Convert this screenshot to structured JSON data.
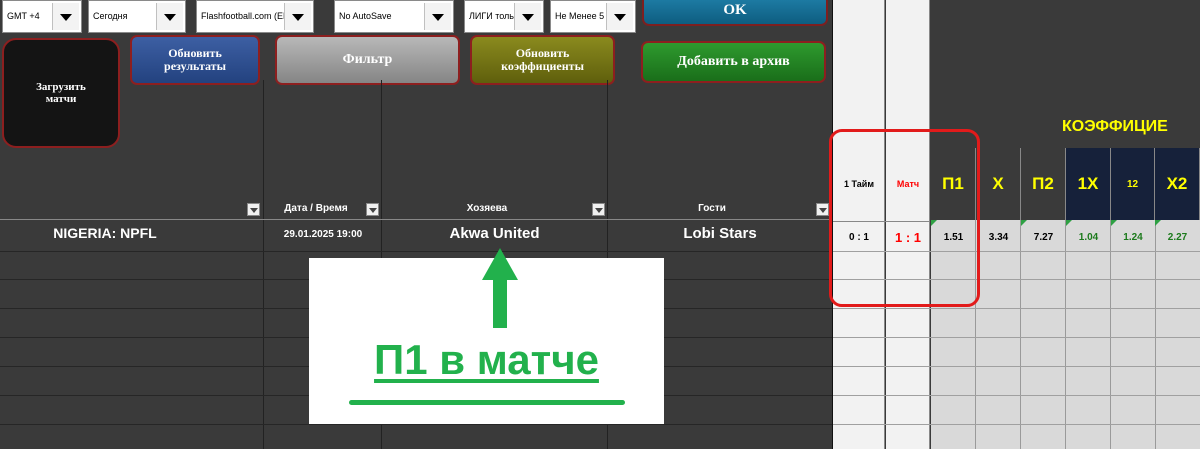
{
  "dropdowns": [
    {
      "value": "GMT +4"
    },
    {
      "value": "Сегодня"
    },
    {
      "value": "Flashfootball.com (EN)"
    },
    {
      "value": "No AutoSave"
    },
    {
      "value": "ЛИГИ толь"
    },
    {
      "value": "Не Менее 5"
    }
  ],
  "buttons": {
    "ok": "OK",
    "load": "Загрузить матчи",
    "refresh_results": "Обновить результаты",
    "filter": "Фильтр",
    "refresh_odds": "Обновить коэффициенты",
    "archive": "Добавить в архив"
  },
  "headers": {
    "datetime": "Дата / Время",
    "home": "Хозяева",
    "away": "Гости",
    "half": "1 Тайм",
    "match": "Матч",
    "odds_group": "КОЭФФИЦИЕ",
    "odds": [
      "П1",
      "Х",
      "П2",
      "1Х",
      "12",
      "Х2"
    ]
  },
  "row": {
    "league": "NIGERIA: NPFL",
    "datetime": "29.01.2025 19:00",
    "home": "Akwa United",
    "away": "Lobi Stars",
    "half": "0 : 1",
    "match": "1 : 1",
    "odds": [
      "1.51",
      "3.34",
      "7.27",
      "1.04",
      "1.24",
      "2.27"
    ]
  },
  "overlay": {
    "caption": "П1 в матче"
  },
  "colors": {
    "odds_header": "#ffff00",
    "match_score": "#ff0000",
    "highlight": "#e21b1b",
    "annotation": "#22b14c"
  }
}
